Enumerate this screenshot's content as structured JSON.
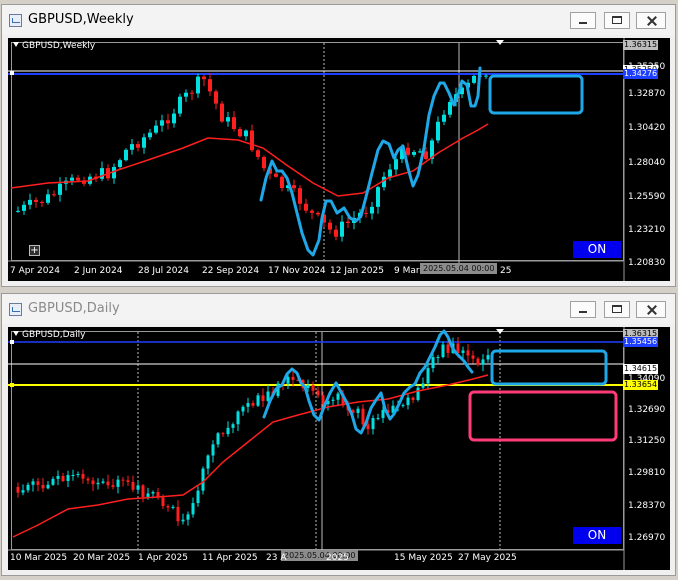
{
  "windows": [
    {
      "title": "GBPUSD,Weekly",
      "symbol_label": "GBPUSD,Weekly",
      "price_labels": [
        "1.36315",
        "1.35250",
        "1.32870",
        "1.30420",
        "1.28040",
        "1.25590",
        "1.23210",
        "1.20830"
      ],
      "price_tags": {
        "white": "1.35250",
        "blue": "1.34276"
      },
      "date_labels": [
        "7 Apr 2024",
        "2 Jun 2024",
        "28 Jul 2024",
        "22 Sep 2024",
        "17 Nov 2024",
        "12 Jan 2025",
        "9 Mar",
        "25"
      ],
      "crosshair_time": "2025.05.04 00:00",
      "on_label": "ON",
      "plus_label": "+"
    },
    {
      "title": "GBPUSD,Daily",
      "symbol_label": "GBPUSD,Daily",
      "price_labels": [
        "1.36315",
        "1.34615",
        "1.34090",
        "1.32690",
        "1.31250",
        "1.29810",
        "1.28370",
        "1.26970"
      ],
      "price_tags": {
        "blue": "1.35456",
        "white": "1.34615",
        "yellow": "1.33654"
      },
      "date_labels": [
        "10 Mar 2025",
        "20 Mar 2025",
        "1 Apr 2025",
        "11 Apr 2025",
        "23 A",
        "2025",
        "15 May 2025",
        "27 May 2025"
      ],
      "crosshair_time": "2025.05.04 00:00",
      "on_label": "ON"
    }
  ],
  "colors": {
    "chart_bg": "#000000",
    "bull": "#00e0e0",
    "bear": "#ff1f1f",
    "ma_line": "#ff1f1f",
    "hline_blue": "#1e3fff",
    "hline_yellow": "#ffff00",
    "drawing_cyan": "#1ea8e8",
    "rect_pink": "#ff3c78"
  },
  "icons": [
    "window-app-icon",
    "minimize-icon",
    "maximize-icon",
    "close-icon",
    "dropdown-triangle-icon",
    "plus-icon"
  ]
}
